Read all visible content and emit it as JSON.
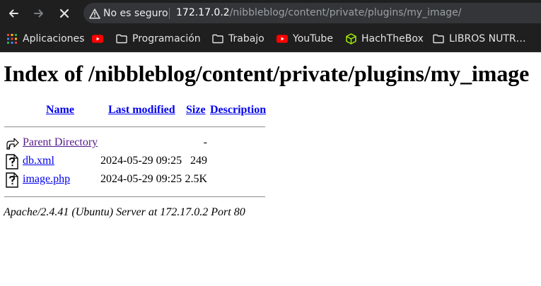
{
  "browser": {
    "security_label": "No es seguro",
    "url_host": "172.17.0.2",
    "url_path": "/nibbleblog/content/private/plugins/my_image/",
    "icons": {
      "back": "back-arrow-icon",
      "forward": "forward-arrow-icon",
      "stop": "stop-x-icon",
      "warning": "warning-triangle-icon"
    }
  },
  "bookmarks": [
    {
      "label": "Aplicaciones",
      "icon": "apps-grid-icon"
    },
    {
      "label": "",
      "icon": "youtube-icon"
    },
    {
      "label": "Programación",
      "icon": "folder-icon"
    },
    {
      "label": "Trabajo",
      "icon": "folder-icon"
    },
    {
      "label": "YouTube",
      "icon": "youtube-icon"
    },
    {
      "label": "HachTheBox",
      "icon": "hackthebox-cube-icon"
    },
    {
      "label": "LIBROS NUTR…",
      "icon": "folder-icon"
    }
  ],
  "page": {
    "title": "Index of /nibbleblog/content/private/plugins/my_image",
    "columns": {
      "name": "Name",
      "last_modified": "Last modified",
      "size": "Size",
      "description": "Description"
    },
    "rows": [
      {
        "name": "Parent Directory",
        "date": "",
        "size": "-",
        "icon": "back-folder-icon",
        "visited": true
      },
      {
        "name": "db.xml",
        "date": "2024-05-29 09:25",
        "size": "249",
        "icon": "unknown-file-icon",
        "visited": false
      },
      {
        "name": "image.php",
        "date": "2024-05-29 09:25",
        "size": "2.5K",
        "icon": "unknown-file-icon",
        "visited": false
      }
    ],
    "footer": "Apache/2.4.41 (Ubuntu) Server at 172.17.0.2 Port 80"
  },
  "colors": {
    "link": "#0000ee",
    "visited_link": "#551a8b",
    "chrome_bg": "#1f1f1f",
    "omnibox_bg": "#333538"
  }
}
